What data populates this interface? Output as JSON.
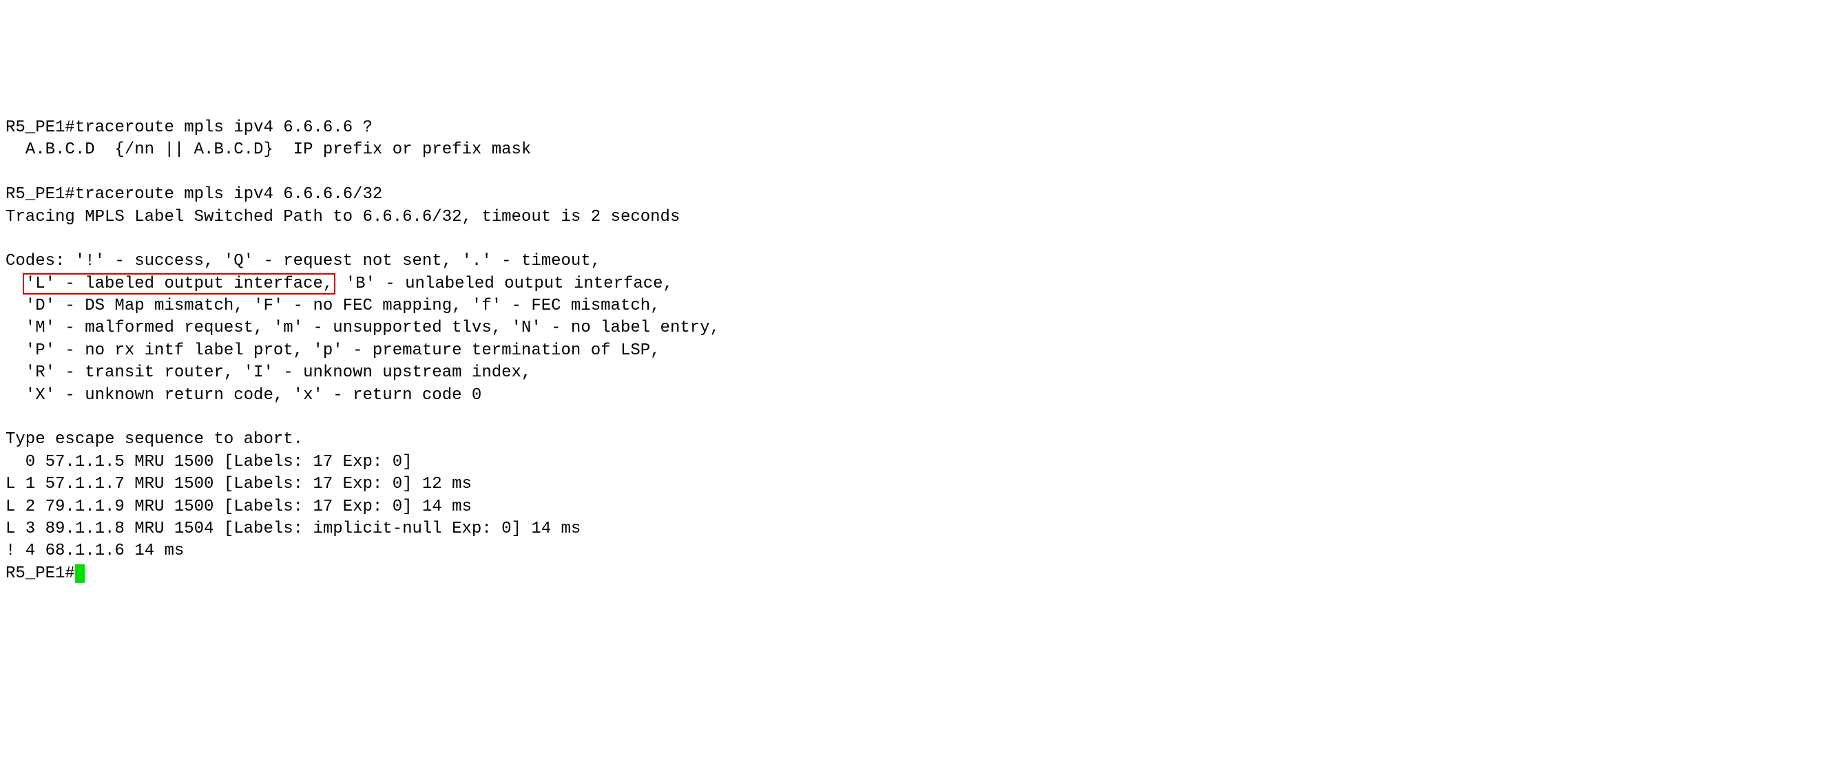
{
  "prompt1": "R5_PE1#",
  "command1": "traceroute mpls ipv4 6.6.6.6 ?",
  "help_line": "  A.B.C.D  {/nn || A.B.C.D}  IP prefix or prefix mask",
  "prompt2": "R5_PE1#",
  "command2": "traceroute mpls ipv4 6.6.6.6/32",
  "tracing_line": "Tracing MPLS Label Switched Path to 6.6.6.6/32, timeout is 2 seconds",
  "codes_line1": "Codes: '!' - success, 'Q' - request not sent, '.' - timeout,",
  "codes_line2_prefix": "  ",
  "codes_line2_highlight": "'L' - labeled output interface,",
  "codes_line2_rest": " 'B' - unlabeled output interface,",
  "codes_line3": "  'D' - DS Map mismatch, 'F' - no FEC mapping, 'f' - FEC mismatch,",
  "codes_line4": "  'M' - malformed request, 'm' - unsupported tlvs, 'N' - no label entry,",
  "codes_line5": "  'P' - no rx intf label prot, 'p' - premature termination of LSP,",
  "codes_line6": "  'R' - transit router, 'I' - unknown upstream index,",
  "codes_line7": "  'X' - unknown return code, 'x' - return code 0",
  "abort_line": "Type escape sequence to abort.",
  "hops": [
    "  0 57.1.1.5 MRU 1500 [Labels: 17 Exp: 0]",
    "L 1 57.1.1.7 MRU 1500 [Labels: 17 Exp: 0] 12 ms",
    "L 2 79.1.1.9 MRU 1500 [Labels: 17 Exp: 0] 14 ms",
    "L 3 89.1.1.8 MRU 1504 [Labels: implicit-null Exp: 0] 14 ms",
    "! 4 68.1.1.6 14 ms"
  ],
  "prompt3": "R5_PE1#"
}
